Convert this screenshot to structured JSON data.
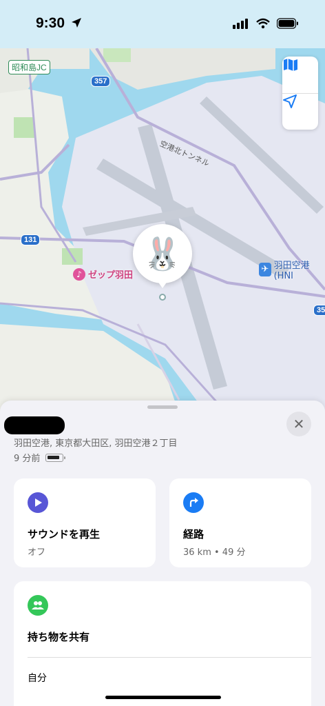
{
  "status_bar": {
    "time": "9:30"
  },
  "map": {
    "junction_label": "昭和島JC",
    "route_357": "357",
    "route_131": "131",
    "route_35": "35",
    "tunnel_label": "空港北トンネル",
    "poi_zepp": "ゼップ羽田",
    "poi_airport": "羽田空港 (HNI",
    "device_emoji": "🐰"
  },
  "map_controls": {
    "map_mode_icon": "map-icon",
    "locate_icon": "location-arrow-icon"
  },
  "sheet": {
    "address": "羽田空港, 東京都大田区, 羽田空港２丁目",
    "last_seen": "9 分前",
    "battery_level": 0.75,
    "close_symbol": "✕"
  },
  "actions": {
    "play_sound": {
      "title": "サウンドを再生",
      "subtitle": "オフ",
      "color": "#5856d6"
    },
    "directions": {
      "title": "経路",
      "subtitle": "36 km • 49 分",
      "color": "#1a7cf4"
    },
    "share": {
      "title": "持ち物を共有",
      "color": "#34c759"
    },
    "self_row": {
      "label": "自分"
    }
  }
}
